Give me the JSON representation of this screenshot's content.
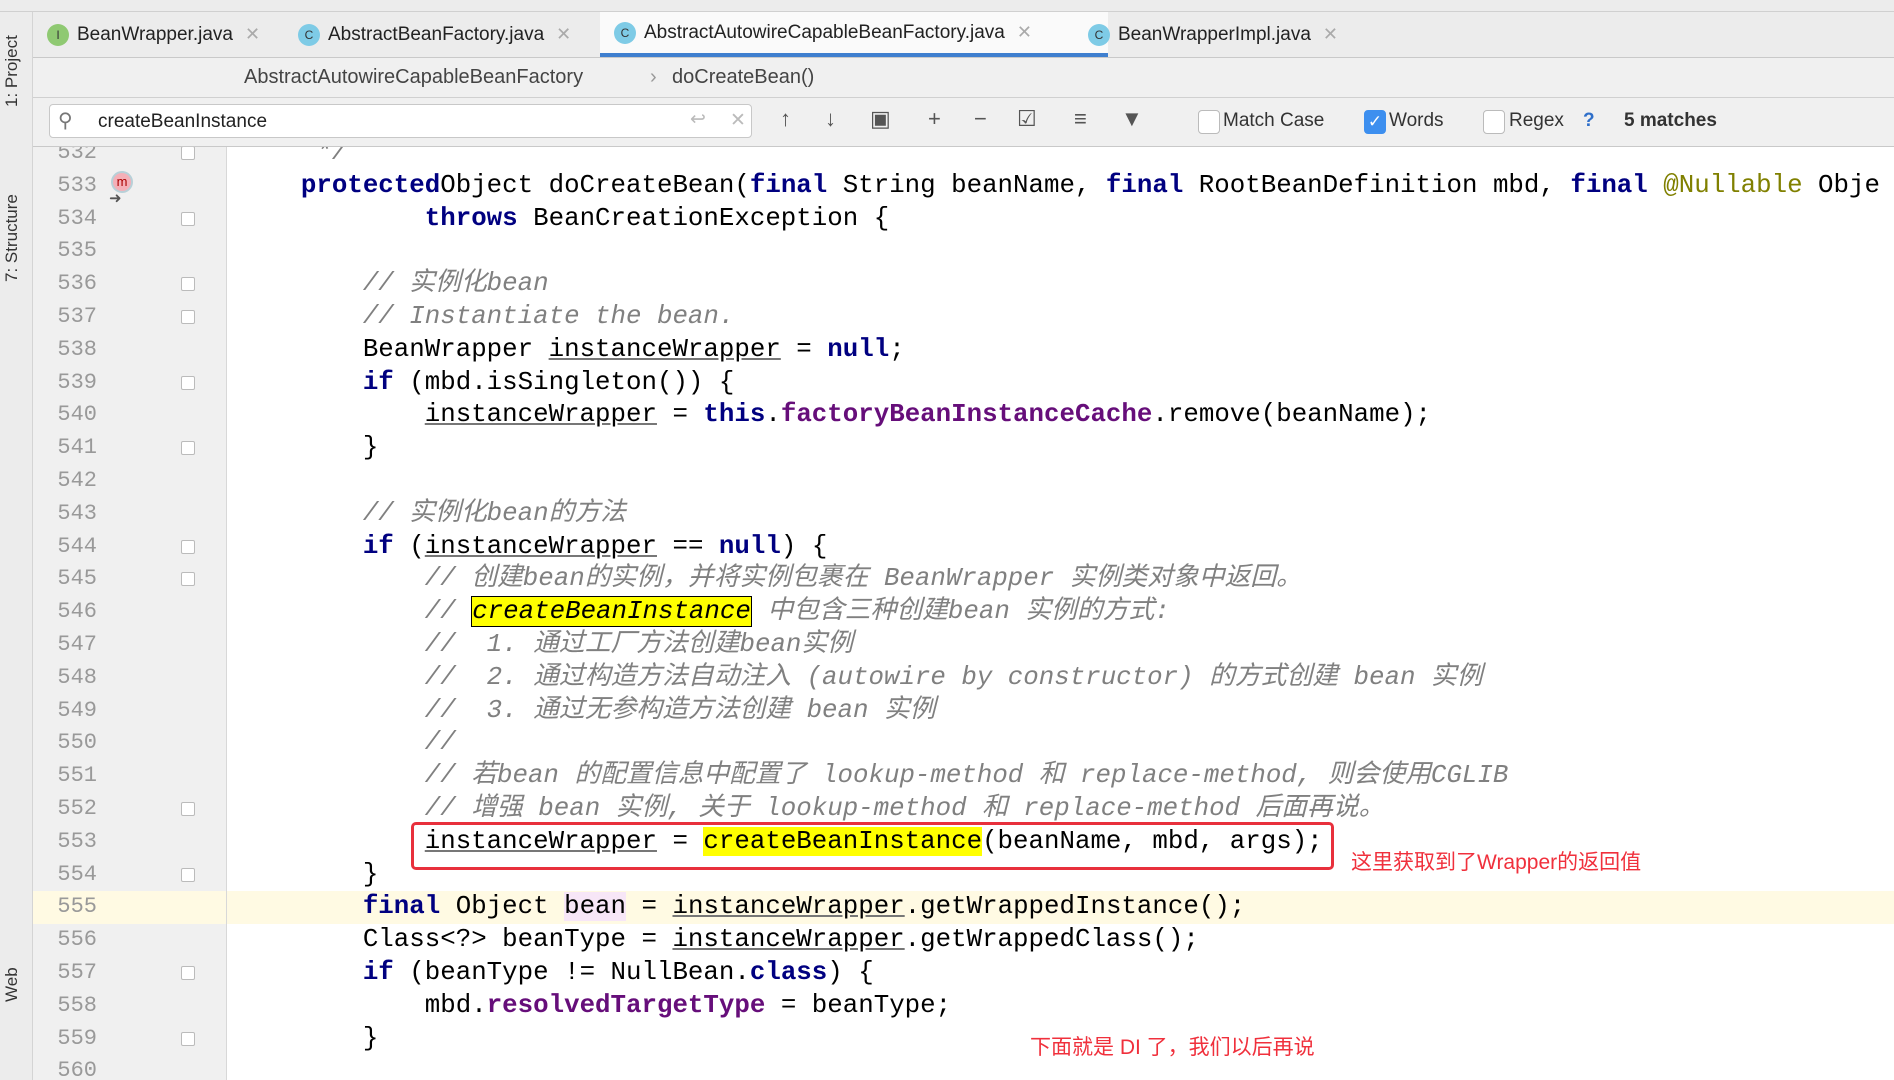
{
  "tool_windows": [
    "1: Project",
    "7: Structure",
    "Web"
  ],
  "tabs": [
    {
      "label": "BeanWrapper.java",
      "icon": "interface-icon",
      "letter": "I",
      "color": "#8fc972",
      "active": false
    },
    {
      "label": "AbstractBeanFactory.java",
      "icon": "class-icon",
      "letter": "C",
      "color": "#7ecbe6",
      "active": false
    },
    {
      "label": "AbstractAutowireCapableBeanFactory.java",
      "icon": "class-icon",
      "letter": "C",
      "color": "#7ecbe6",
      "active": true
    },
    {
      "label": "BeanWrapperImpl.java",
      "icon": "class-icon",
      "letter": "C",
      "color": "#7ecbe6",
      "active": false
    }
  ],
  "breadcrumb": {
    "class": "AbstractAutowireCapableBeanFactory",
    "method": "doCreateBean()"
  },
  "search": {
    "value": "createBeanInstance",
    "match_case": false,
    "words": true,
    "regex": false,
    "match_case_label": "Match Case",
    "words_label": "Words",
    "regex_label": "Regex",
    "help": "?",
    "matches": "5 matches"
  },
  "caret_line": 555,
  "code": [
    {
      "n": 532,
      "i": 5,
      "t": [
        [
          "cm",
          "*/"
        ]
      ]
    },
    {
      "n": 533,
      "i": 4,
      "t": [
        [
          "kw",
          "protected"
        ],
        [
          "",
          "Object doCreateBean("
        ],
        [
          "kw",
          "final"
        ],
        [
          "",
          " String beanName, "
        ],
        [
          "kw",
          "final"
        ],
        [
          "",
          " RootBeanDefinition mbd, "
        ],
        [
          "kw",
          "final"
        ],
        [
          "",
          " "
        ],
        [
          "ann",
          "@Nullable"
        ],
        [
          "",
          " Obje"
        ]
      ]
    },
    {
      "n": 534,
      "i": 12,
      "t": [
        [
          "kw",
          "throws"
        ],
        [
          "",
          " BeanCreationException {"
        ]
      ]
    },
    {
      "n": 535,
      "i": 0,
      "t": []
    },
    {
      "n": 536,
      "i": 8,
      "t": [
        [
          "cm",
          "// 实例化bean"
        ]
      ]
    },
    {
      "n": 537,
      "i": 8,
      "t": [
        [
          "cm",
          "// Instantiate the bean."
        ]
      ]
    },
    {
      "n": 538,
      "i": 8,
      "t": [
        [
          "",
          "BeanWrapper "
        ],
        [
          "u",
          "instanceWrapper"
        ],
        [
          "",
          " = "
        ],
        [
          "kw",
          "null"
        ],
        [
          "",
          ";"
        ]
      ]
    },
    {
      "n": 539,
      "i": 8,
      "t": [
        [
          "kw",
          "if"
        ],
        [
          "",
          " (mbd.isSingleton()) {"
        ]
      ]
    },
    {
      "n": 540,
      "i": 12,
      "t": [
        [
          "u",
          "instanceWrapper"
        ],
        [
          "",
          " = "
        ],
        [
          "kw",
          "this"
        ],
        [
          "",
          "."
        ],
        [
          "fld",
          "factoryBeanInstanceCache"
        ],
        [
          "",
          ".remove(beanName);"
        ]
      ]
    },
    {
      "n": 541,
      "i": 8,
      "t": [
        [
          "",
          "}"
        ]
      ]
    },
    {
      "n": 542,
      "i": 0,
      "t": []
    },
    {
      "n": 543,
      "i": 8,
      "t": [
        [
          "cm",
          "// 实例化bean的方法"
        ]
      ]
    },
    {
      "n": 544,
      "i": 8,
      "t": [
        [
          "kw",
          "if"
        ],
        [
          "",
          " ("
        ],
        [
          "u",
          "instanceWrapper"
        ],
        [
          "",
          " == "
        ],
        [
          "kw",
          "null"
        ],
        [
          "",
          ") {"
        ]
      ]
    },
    {
      "n": 545,
      "i": 12,
      "t": [
        [
          "cm",
          "// 创建bean的实例，并将实例包裹在 BeanWrapper 实例类对象中返回。"
        ]
      ]
    },
    {
      "n": 546,
      "i": 12,
      "t": [
        [
          "cm",
          "// "
        ],
        [
          "hlb",
          "createBeanInstance"
        ],
        [
          "cm",
          " 中包含三种创建bean 实例的方式:"
        ]
      ]
    },
    {
      "n": 547,
      "i": 12,
      "t": [
        [
          "cm",
          "//  1. 通过工厂方法创建bean实例"
        ]
      ]
    },
    {
      "n": 548,
      "i": 12,
      "t": [
        [
          "cm",
          "//  2. 通过构造方法自动注入 (autowire by constructor) 的方式创建 bean 实例"
        ]
      ]
    },
    {
      "n": 549,
      "i": 12,
      "t": [
        [
          "cm",
          "//  3. 通过无参构造方法创建 bean 实例"
        ]
      ]
    },
    {
      "n": 550,
      "i": 12,
      "t": [
        [
          "cm",
          "//"
        ]
      ]
    },
    {
      "n": 551,
      "i": 12,
      "t": [
        [
          "cm",
          "// 若bean 的配置信息中配置了 lookup-method 和 replace-method, 则会使用CGLIB"
        ]
      ]
    },
    {
      "n": 552,
      "i": 12,
      "t": [
        [
          "cm",
          "// 增强 bean 实例, 关于 lookup-method 和 replace-method 后面再说。"
        ]
      ]
    },
    {
      "n": 553,
      "i": 12,
      "t": [
        [
          "u",
          "instanceWrapper"
        ],
        [
          "",
          " = "
        ],
        [
          "hl plain",
          "createBeanInstance"
        ],
        [
          "",
          "(beanName, mbd, args);"
        ]
      ]
    },
    {
      "n": 554,
      "i": 8,
      "t": [
        [
          "",
          "}"
        ]
      ]
    },
    {
      "n": 555,
      "i": 8,
      "t": [
        [
          "kw",
          "final"
        ],
        [
          "",
          " Object "
        ],
        [
          "hb",
          "bean"
        ],
        [
          "",
          " = "
        ],
        [
          "u",
          "instanceWrapper"
        ],
        [
          "",
          ".getWrappedInstance();"
        ]
      ]
    },
    {
      "n": 556,
      "i": 8,
      "t": [
        [
          "",
          "Class<?> beanType = "
        ],
        [
          "u",
          "instanceWrapper"
        ],
        [
          "",
          ".getWrappedClass();"
        ]
      ]
    },
    {
      "n": 557,
      "i": 8,
      "t": [
        [
          "kw",
          "if"
        ],
        [
          "",
          " (beanType != NullBean."
        ],
        [
          "kw",
          "class"
        ],
        [
          "",
          ") {"
        ]
      ]
    },
    {
      "n": 558,
      "i": 12,
      "t": [
        [
          "",
          "mbd."
        ],
        [
          "fld",
          "resolvedTargetType"
        ],
        [
          "",
          " = beanType;"
        ]
      ]
    },
    {
      "n": 559,
      "i": 8,
      "t": [
        [
          "",
          "}"
        ]
      ]
    },
    {
      "n": 560,
      "i": 0,
      "t": []
    }
  ],
  "folds": [
    532,
    534,
    536,
    537,
    539,
    541,
    544,
    545,
    552,
    554,
    557,
    559
  ],
  "annotations": {
    "note1": "这里获取到了Wrapper的返回值",
    "note2": "下面就是 DI 了，我们以后再说",
    "color": "#e8303c"
  }
}
